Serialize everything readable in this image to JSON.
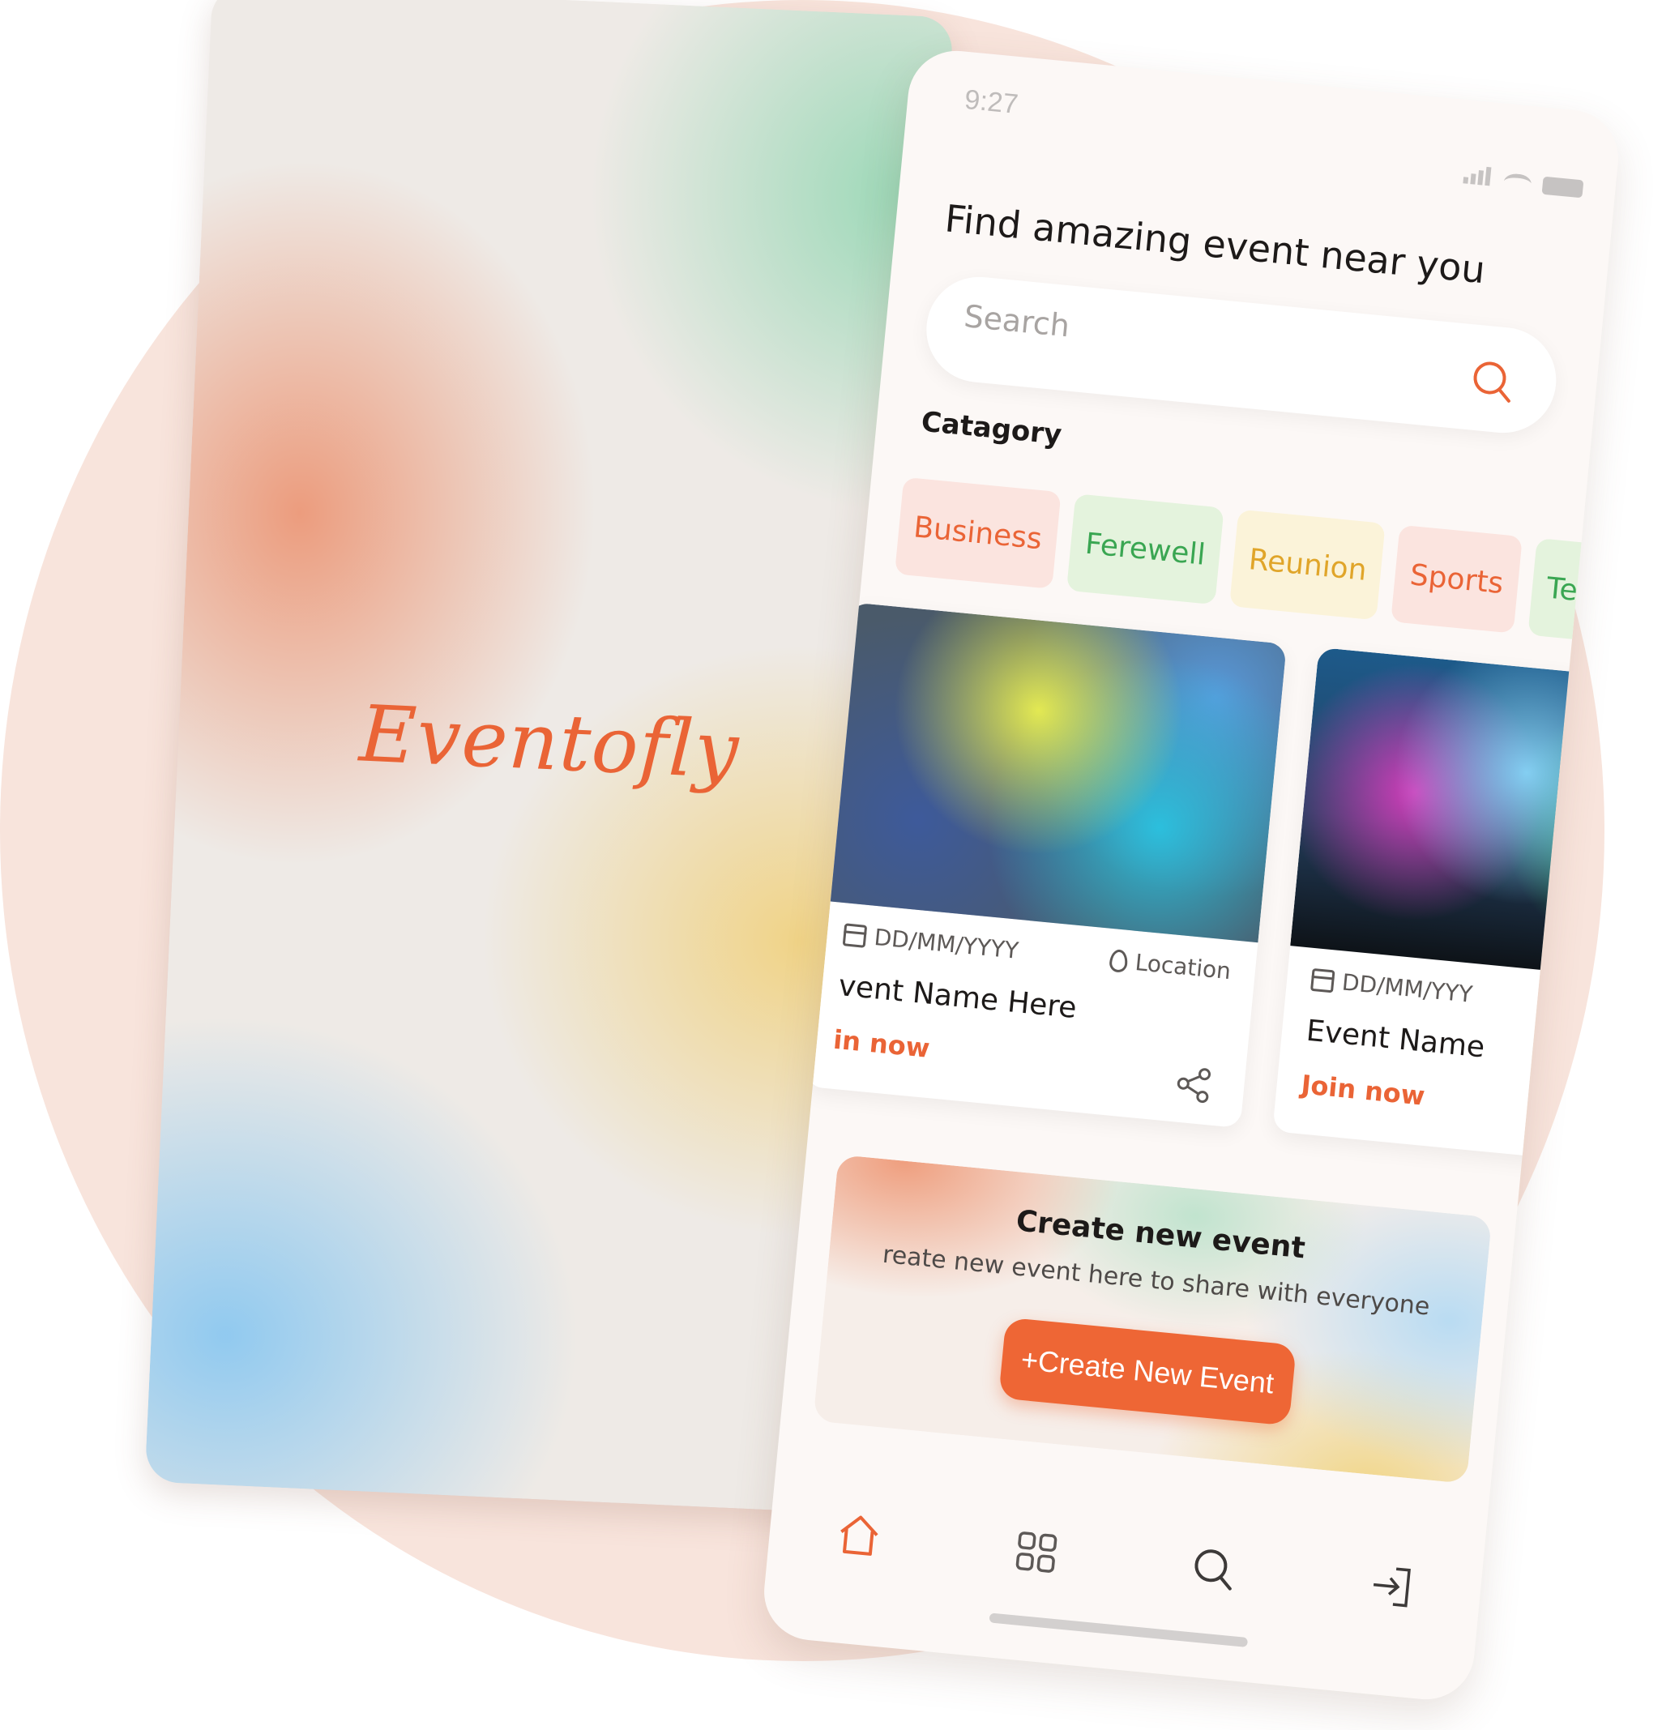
{
  "splash": {
    "logo": "Eventofly"
  },
  "status": {
    "time": "9:27"
  },
  "home": {
    "headline": "Find amazing event near you",
    "search": {
      "placeholder": "Search"
    },
    "category_title": "Catagory",
    "categories": [
      {
        "label": "Business"
      },
      {
        "label": "Ferewell"
      },
      {
        "label": "Reunion"
      },
      {
        "label": "Sports"
      },
      {
        "label": "Tec"
      }
    ],
    "events": [
      {
        "date": "DD/MM/YYYY",
        "location": "Location",
        "name": "vent Name Here",
        "cta": "in now"
      },
      {
        "date": "DD/MM/YYY",
        "name": "Event Name",
        "cta": "Join now"
      }
    ],
    "create": {
      "title": "Create new event",
      "subtitle": "reate new event here to share with everyone",
      "button": "+Create New Event"
    }
  },
  "colors": {
    "accent": "#ea6436",
    "background_circle": "#f8e4dc"
  },
  "icons": [
    "home-icon",
    "grid-icon",
    "search-icon",
    "login-icon",
    "share-icon",
    "calendar-icon",
    "location-pin-icon"
  ]
}
